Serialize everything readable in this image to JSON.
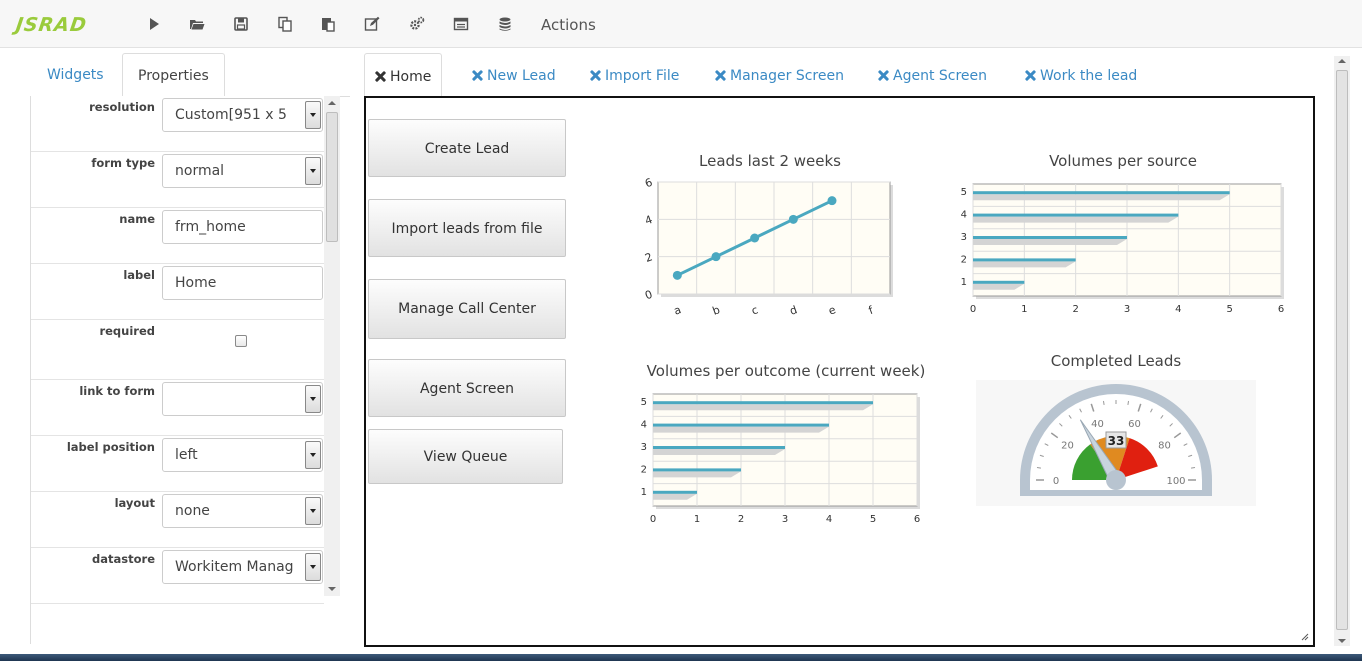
{
  "app": {
    "logo_text": "JSRAD",
    "actions_label": "Actions",
    "accent_color": "#9acb3c",
    "link_color": "#3b8ac4"
  },
  "toolbar": {
    "icons": [
      "play-icon",
      "open-folder-icon",
      "save-icon",
      "copy-icon",
      "paste-icon",
      "edit-icon",
      "settings-icon",
      "window-icon",
      "database-icon"
    ]
  },
  "left_tabs": {
    "widgets": "Widgets",
    "properties": "Properties"
  },
  "properties": [
    {
      "label": "resolution",
      "type": "select",
      "value": "Custom[951 x 5"
    },
    {
      "label": "form type",
      "type": "select",
      "value": "normal"
    },
    {
      "label": "name",
      "type": "text",
      "value": "frm_home"
    },
    {
      "label": "label",
      "type": "text",
      "value": "Home"
    },
    {
      "label": "required",
      "type": "checkbox",
      "value": ""
    },
    {
      "label": "link to form",
      "type": "select",
      "value": ""
    },
    {
      "label": "label position",
      "type": "select",
      "value": "left"
    },
    {
      "label": "layout",
      "type": "select",
      "value": "none"
    },
    {
      "label": "datastore",
      "type": "select",
      "value": "Workitem Manag"
    }
  ],
  "main_tabs": [
    "Home",
    "New Lead",
    "Import File",
    "Manager Screen",
    "Agent Screen",
    "Work the lead"
  ],
  "form_buttons": [
    "Create Lead",
    "Import leads from file",
    "Manage Call Center",
    "Agent Screen",
    "View Queue"
  ],
  "chart_data": [
    {
      "type": "line",
      "title": "Leads last 2 weeks",
      "categories": [
        "a",
        "b",
        "c",
        "d",
        "e",
        "f"
      ],
      "values": [
        1,
        2,
        3,
        4,
        5
      ],
      "ylim": [
        0,
        6
      ],
      "yticks": [
        "0",
        "2",
        "4",
        "6"
      ],
      "grid": true,
      "color": "#4aa8c0"
    },
    {
      "type": "bar",
      "orientation": "horizontal",
      "title": "Volumes per source",
      "categories": [
        "1",
        "2",
        "3",
        "4",
        "5"
      ],
      "values": [
        1,
        2,
        3,
        4,
        5
      ],
      "xlim": [
        0,
        6
      ],
      "xticks": [
        "0",
        "1",
        "2",
        "3",
        "4",
        "5",
        "6"
      ],
      "grid": true,
      "color": "#4aa8c0"
    },
    {
      "type": "bar",
      "orientation": "horizontal",
      "title": "Volumes per outcome (current week)",
      "categories": [
        "1",
        "2",
        "3",
        "4",
        "5"
      ],
      "values": [
        1,
        2,
        3,
        4,
        5
      ],
      "xlim": [
        0,
        6
      ],
      "xticks": [
        "0",
        "1",
        "2",
        "3",
        "4",
        "5",
        "6"
      ],
      "grid": true,
      "color": "#4aa8c0"
    },
    {
      "type": "gauge",
      "title": "Completed Leads",
      "value": 33,
      "value_label": "33",
      "range": [
        0,
        100
      ],
      "tick_labels": [
        "0",
        "20",
        "40",
        "60",
        "80",
        "100"
      ],
      "bands": [
        {
          "from": 0,
          "to": 30,
          "color": "#3aa030"
        },
        {
          "from": 30,
          "to": 60,
          "color": "#e08a20"
        },
        {
          "from": 60,
          "to": 90,
          "color": "#e02010"
        }
      ]
    }
  ]
}
